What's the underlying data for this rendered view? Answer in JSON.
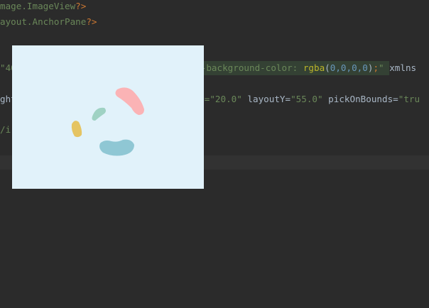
{
  "code": {
    "line1": {
      "path": "mage.ImageView",
      "end": "?>"
    },
    "line2": {
      "path": "ayout.AnchorPane",
      "end": "?>"
    },
    "line3": {
      "prefix": "\"40",
      "prop": "-background-color:",
      "fn": "rgba",
      "open": "(",
      "args": "0,0,0,0",
      "close": ")",
      "semi": ";",
      "quote": "\"",
      "tail": " xmlns"
    },
    "line4": {
      "prefix": "ght",
      "v1": "=\"20.0\"",
      "attr2": " layoutY=",
      "v2": "\"55.0\"",
      "attr3": " pickOnBounds=",
      "v3": "\"tru"
    },
    "line5": {
      "text": "/i"
    }
  },
  "preview": {
    "background": "#e1f2fa",
    "shape_colors": {
      "pink": "#fbb3b5",
      "mint": "#9fd2c3",
      "mustard": "#e5c462",
      "teal": "#8fc7d4"
    }
  }
}
